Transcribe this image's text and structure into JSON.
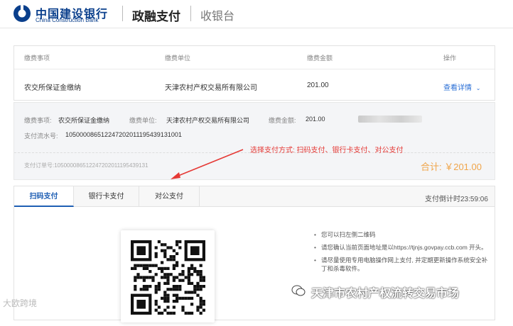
{
  "header": {
    "bank_name_cn": "中国建设银行",
    "bank_name_en": "China Construction Bank",
    "product": "政融支付",
    "page": "收银台"
  },
  "table": {
    "headers": [
      "缴费事项",
      "缴费单位",
      "缴费金额",
      "操作"
    ],
    "row": {
      "item": "农交所保证金缴纳",
      "unit": "天津农村产权交易所有限公司",
      "amount": "201.00",
      "action": "查看详情"
    }
  },
  "summary": {
    "item_label": "缴费事项:",
    "item_value": "农交所保证金缴纳",
    "unit_label": "缴费单位:",
    "unit_value": "天津农村产权交易所有限公司",
    "amount_label": "缴费金额:",
    "amount_value": "201.00",
    "serial_label": "支付流水号:",
    "serial_value": "105000086512247202011195439131001",
    "order_label": "支付订单号:",
    "order_value": "105000086512247202011195439131",
    "total": "合计: ￥201.00"
  },
  "annotation": "选择支付方式: 扫码支付、银行卡支付、对公支付",
  "pay": {
    "tabs": [
      "扫码支付",
      "银行卡支付",
      "对公支付"
    ],
    "active_tab": 0,
    "countdown": "支付倒计时23:59:06",
    "tips": [
      "您可以扫左侧二维码",
      "请您确认当前页面地址是以https://tjnjs.govpay.ccb.com 开头。",
      "请尽量使用专用电脑操作网上支付, 并定期更新操作系统安全补丁和杀毒软件。"
    ]
  },
  "watermarks": {
    "left": "大欧跨境",
    "right": "天津市农村产权流转交易市场"
  },
  "colors": {
    "brand": "#0a3f8c",
    "link": "#2a6fd6",
    "total": "#f0a54a",
    "annotation": "#e53935"
  }
}
